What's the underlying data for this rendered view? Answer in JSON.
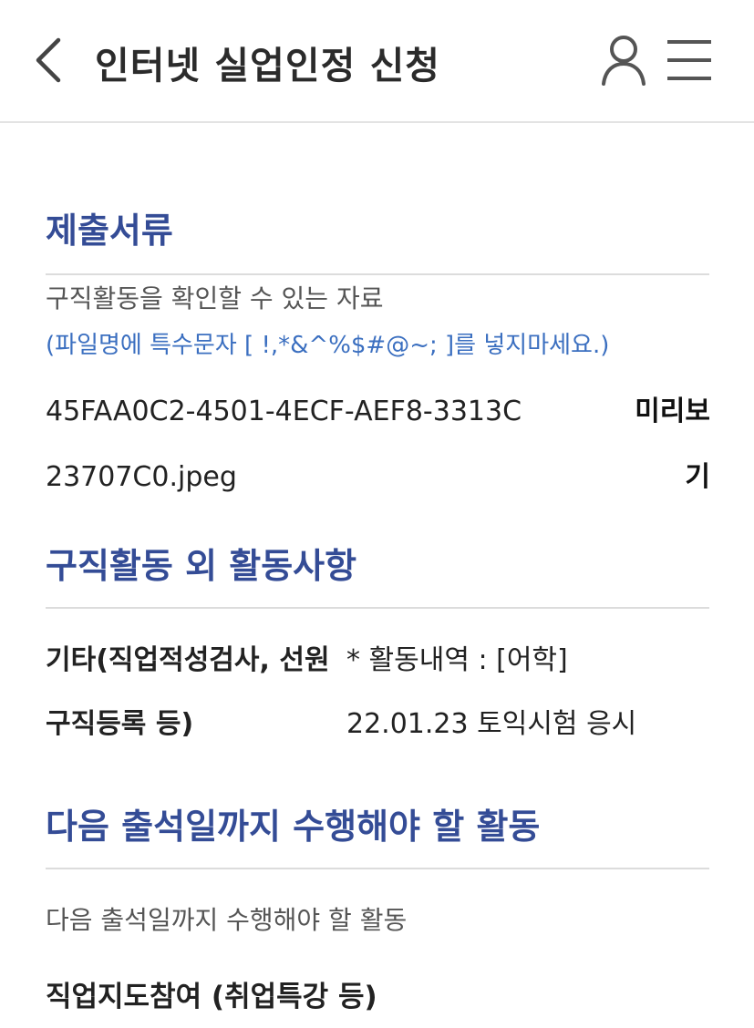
{
  "header": {
    "title": "인터넷 실업인정 신청",
    "icons": [
      "back-arrow",
      "user",
      "hamburger-menu"
    ]
  },
  "documents": {
    "title": "제출서류",
    "description": "구직활동을 확인할 수 있는 자료",
    "note": "(파일명에 특수문자 [ !,*&^%$#@~; ]를 넣지마세요.)",
    "file_name": "45FAA0C2-4501-4ECF-AEF8-3313C23707C0.jpeg",
    "preview_label": "미리보기"
  },
  "other_activity": {
    "title": "구직활동 외 활동사항",
    "label": "기타(직업적성검사, 선원 구직등록 등)",
    "value": "* 활동내역 : [어학] 22.01.23 토익시험 응시"
  },
  "next_activity": {
    "title": "다음 출석일까지 수행해야 할 활동",
    "description": "다음 출석일까지 수행해야 할 활동",
    "item": "직업지도참여 (취업특강 등)"
  },
  "colors": {
    "accent": "#344c96",
    "note": "#3b6fc0",
    "divider": "#dcdcdc"
  }
}
